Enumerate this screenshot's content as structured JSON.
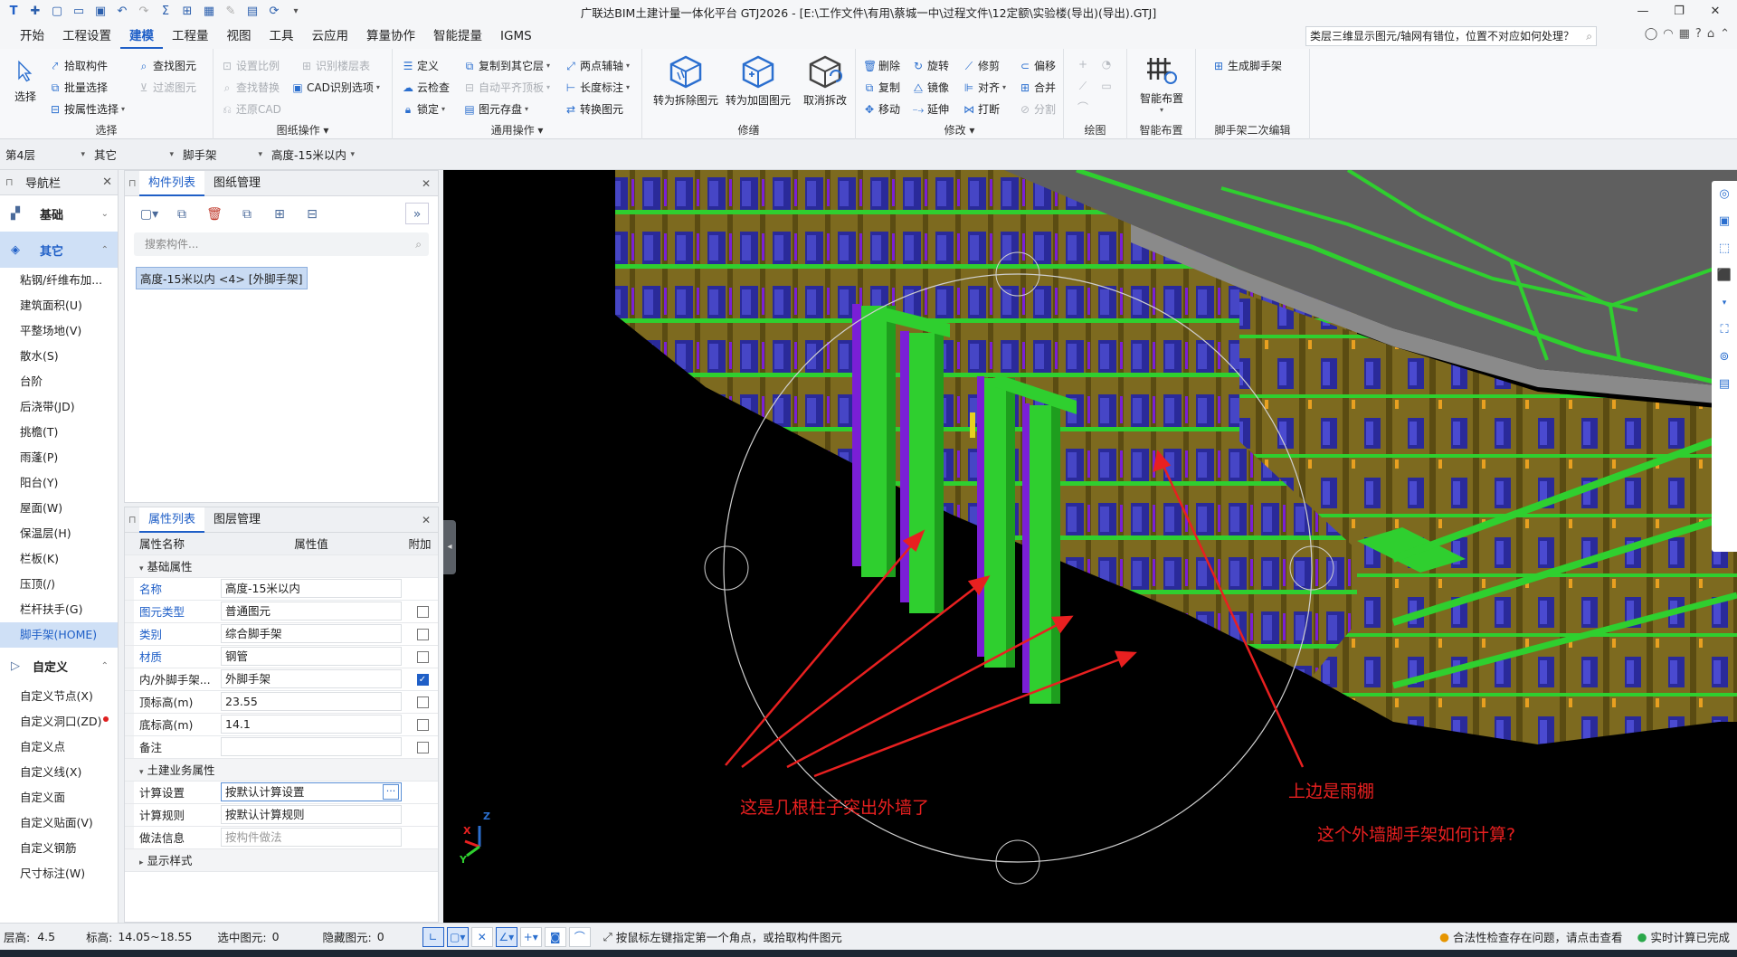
{
  "title": "广联达BIM土建计量一体化平台 GTJ2026 - [E:\\工作文件\\有用\\蔡城一中\\过程文件\\12定额\\实验楼(导出)(导出).GTJ]",
  "menu": {
    "tabs": [
      "开始",
      "工程设置",
      "建模",
      "工程量",
      "视图",
      "工具",
      "云应用",
      "算量协作",
      "智能提量",
      "IGMS"
    ],
    "active": "建模",
    "search_value": "类层三维显示图元/轴网有错位，位置不对应如何处理？"
  },
  "ribbon": {
    "select": {
      "big": "选择",
      "items": [
        "拾取构件",
        "批量选择",
        "按属性选择",
        "查找图元",
        "过滤图元"
      ],
      "label": "选择"
    },
    "drawing_ops": {
      "items": [
        "设置比例",
        "查找替换",
        "还原CAD",
        "识别楼层表",
        "CAD识别选项"
      ],
      "label": "图纸操作"
    },
    "general_ops": {
      "items": [
        "定义",
        "云检查",
        "锁定",
        "复制到其它层",
        "自动平齐顶板",
        "图元存盘",
        "两点辅轴",
        "长度标注",
        "转换图元"
      ],
      "label": "通用操作"
    },
    "repair": {
      "items": [
        "转为拆除图元",
        "转为加固图元",
        "取消拆改"
      ],
      "label": "修缮"
    },
    "modify": {
      "items": [
        "删除",
        "复制",
        "移动",
        "旋转",
        "镜像",
        "延伸",
        "修剪",
        "对齐",
        "打断",
        "偏移",
        "合并",
        "分割"
      ],
      "label": "修改"
    },
    "draw": {
      "label": "绘图"
    },
    "smart": {
      "big": "智能布置",
      "label": "智能布置"
    },
    "scaffold": {
      "item": "生成脚手架",
      "label": "脚手架二次编辑"
    }
  },
  "filters": [
    "第4层",
    "其它",
    "脚手架",
    "高度-15米以内"
  ],
  "nav": {
    "title": "导航栏",
    "categories": {
      "base": "基础",
      "other": "其它",
      "custom": "自定义"
    },
    "other_items": [
      "粘钢/纤维布加...",
      "建筑面积(U)",
      "平整场地(V)",
      "散水(S)",
      "台阶",
      "后浇带(JD)",
      "挑檐(T)",
      "雨蓬(P)",
      "阳台(Y)",
      "屋面(W)",
      "保温层(H)",
      "栏板(K)",
      "压顶(/)",
      "栏杆扶手(G)",
      "脚手架(HOME)"
    ],
    "custom_items": [
      "自定义节点(X)",
      "自定义洞口(ZD)",
      "自定义点",
      "自定义线(X)",
      "自定义面",
      "自定义贴面(V)",
      "自定义钢筋",
      "尺寸标注(W)"
    ]
  },
  "component_panel": {
    "tabs": [
      "构件列表",
      "图纸管理"
    ],
    "search_placeholder": "搜索构件...",
    "selected": "高度-15米以内 <4> [外脚手架]"
  },
  "property_panel": {
    "tabs": [
      "属性列表",
      "图层管理"
    ],
    "headers": [
      "属性名称",
      "属性值",
      "附加"
    ],
    "section_basic": "基础属性",
    "rows": [
      {
        "name": "名称",
        "value": "高度-15米以内",
        "blue": true,
        "check": null
      },
      {
        "name": "图元类型",
        "value": "普通图元",
        "blue": true,
        "check": false
      },
      {
        "name": "类别",
        "value": "综合脚手架",
        "blue": true,
        "check": false
      },
      {
        "name": "材质",
        "value": "钢管",
        "blue": true,
        "check": false
      },
      {
        "name": "内/外脚手架...",
        "value": "外脚手架",
        "blue": false,
        "check": true
      },
      {
        "name": "顶标高(m)",
        "value": "23.55",
        "blue": false,
        "check": false
      },
      {
        "name": "底标高(m)",
        "value": "14.1",
        "blue": false,
        "check": false
      },
      {
        "name": "备注",
        "value": "",
        "blue": false,
        "check": false
      }
    ],
    "section_business": "土建业务属性",
    "business_rows": [
      {
        "name": "计算设置",
        "value": "按默认计算设置",
        "edit": true
      },
      {
        "name": "计算规则",
        "value": "按默认计算规则",
        "edit": false
      },
      {
        "name": "做法信息",
        "value": "按构件做法",
        "edit": false,
        "placeholder": true
      }
    ],
    "section_display": "显示样式"
  },
  "viewport": {
    "annotations": [
      "这是几根柱子突出外墙了",
      "上边是雨棚",
      "这个外墙脚手架如何计算?"
    ],
    "axes": [
      "X",
      "Y",
      "Z"
    ],
    "annotation_color": "#e82020"
  },
  "status": {
    "floor_height_label": "层高:",
    "floor_height": "4.5",
    "elevation_label": "标高:",
    "elevation": "14.05~18.55",
    "selected_label": "选中图元:",
    "selected": "0",
    "hidden_label": "隐藏图元:",
    "hidden": "0",
    "hint": "按鼠标左键指定第一个角点，或拾取构件图元",
    "warn": "合法性检查存在问题，请点击查看",
    "ok": "实时计算已完成"
  }
}
